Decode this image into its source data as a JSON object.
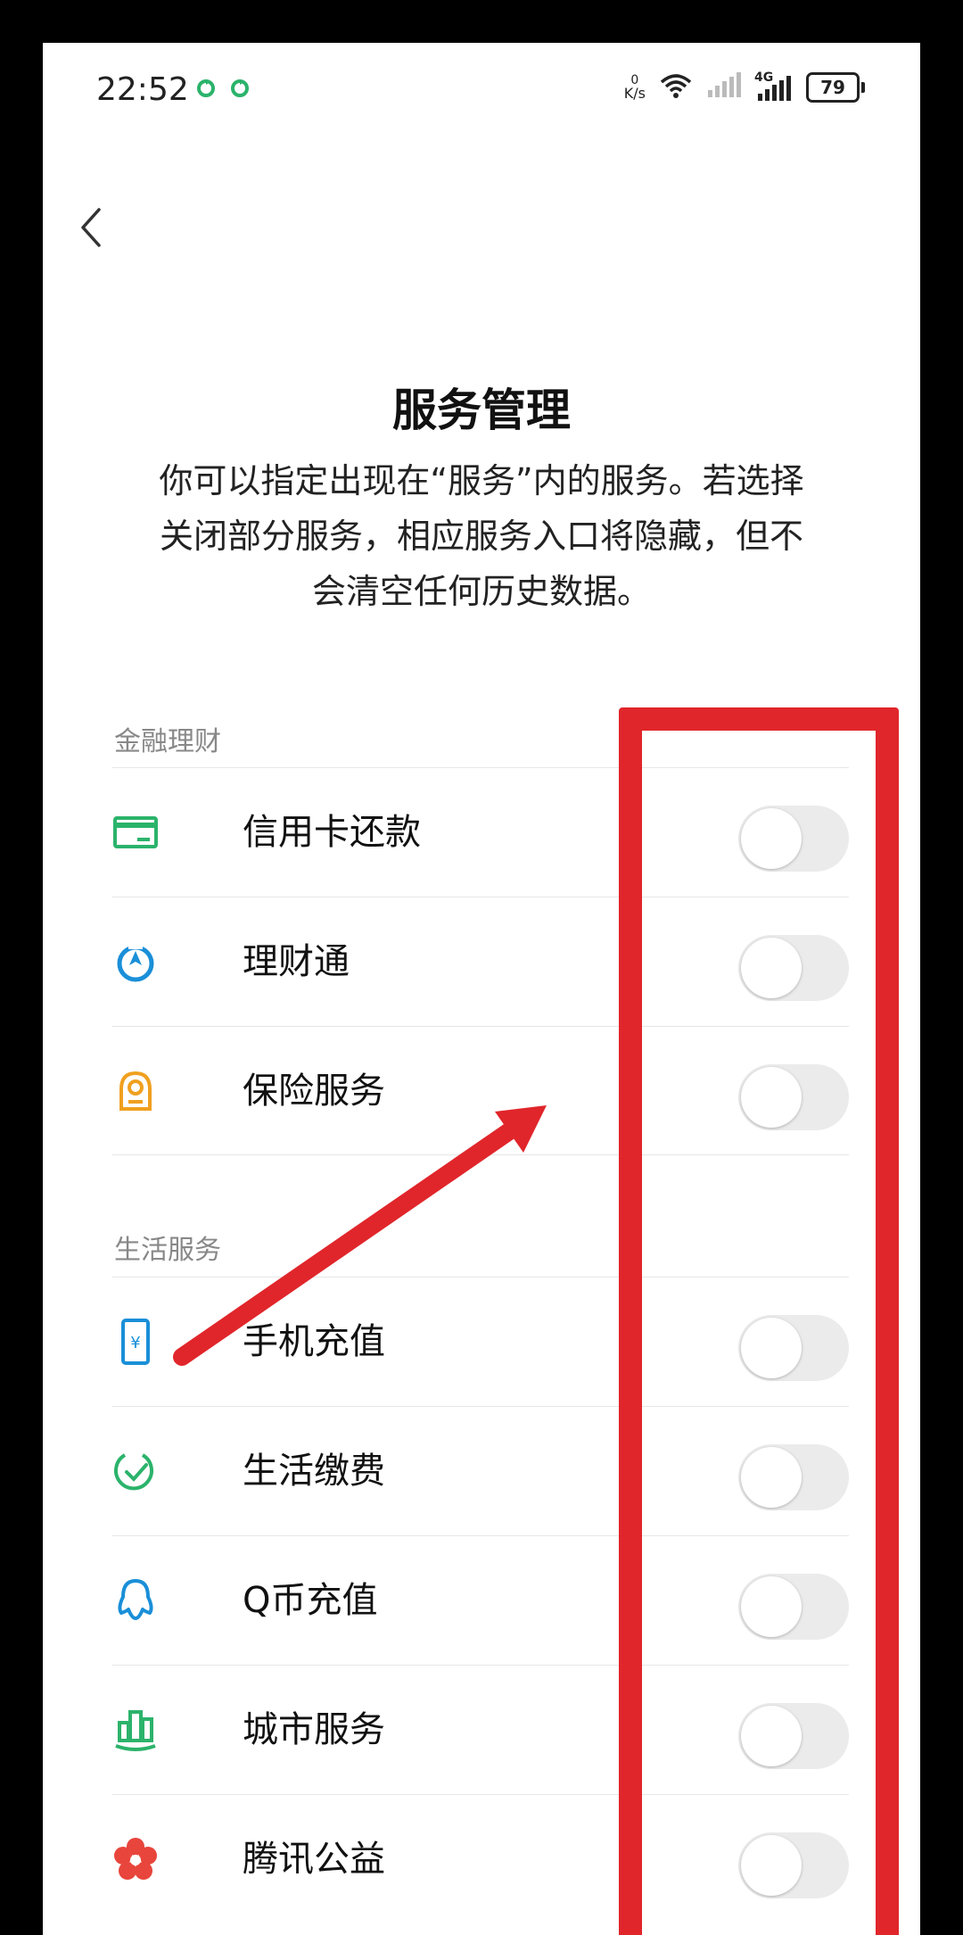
{
  "status_bar": {
    "time": "22:52",
    "net_speed_value": "0",
    "net_speed_unit": "K/s",
    "network_type": "4G",
    "battery": "79"
  },
  "page": {
    "title": "服务管理",
    "description_lines": [
      "你可以指定出现在“服务”内的服务。若选择",
      "关闭部分服务，相应服务入口将隐藏，但不",
      "会清空任何历史数据。"
    ]
  },
  "sections": [
    {
      "title": "金融理财",
      "items": [
        {
          "label": "信用卡还款",
          "icon": "credit-card-icon",
          "enabled": false
        },
        {
          "label": "理财通",
          "icon": "wealth-icon",
          "enabled": false
        },
        {
          "label": "保险服务",
          "icon": "insurance-icon",
          "enabled": false
        }
      ]
    },
    {
      "title": "生活服务",
      "items": [
        {
          "label": "手机充值",
          "icon": "phone-topup-icon",
          "enabled": false
        },
        {
          "label": "生活缴费",
          "icon": "bill-payment-icon",
          "enabled": false
        },
        {
          "label": "Q币充值",
          "icon": "qq-coin-icon",
          "enabled": false
        },
        {
          "label": "城市服务",
          "icon": "city-services-icon",
          "enabled": false
        },
        {
          "label": "腾讯公益",
          "icon": "charity-icon",
          "enabled": false
        }
      ]
    }
  ],
  "colors": {
    "accent_green": "#2bb36b",
    "annotation_red": "#e0262b",
    "toggle_off": "#ebebeb"
  }
}
